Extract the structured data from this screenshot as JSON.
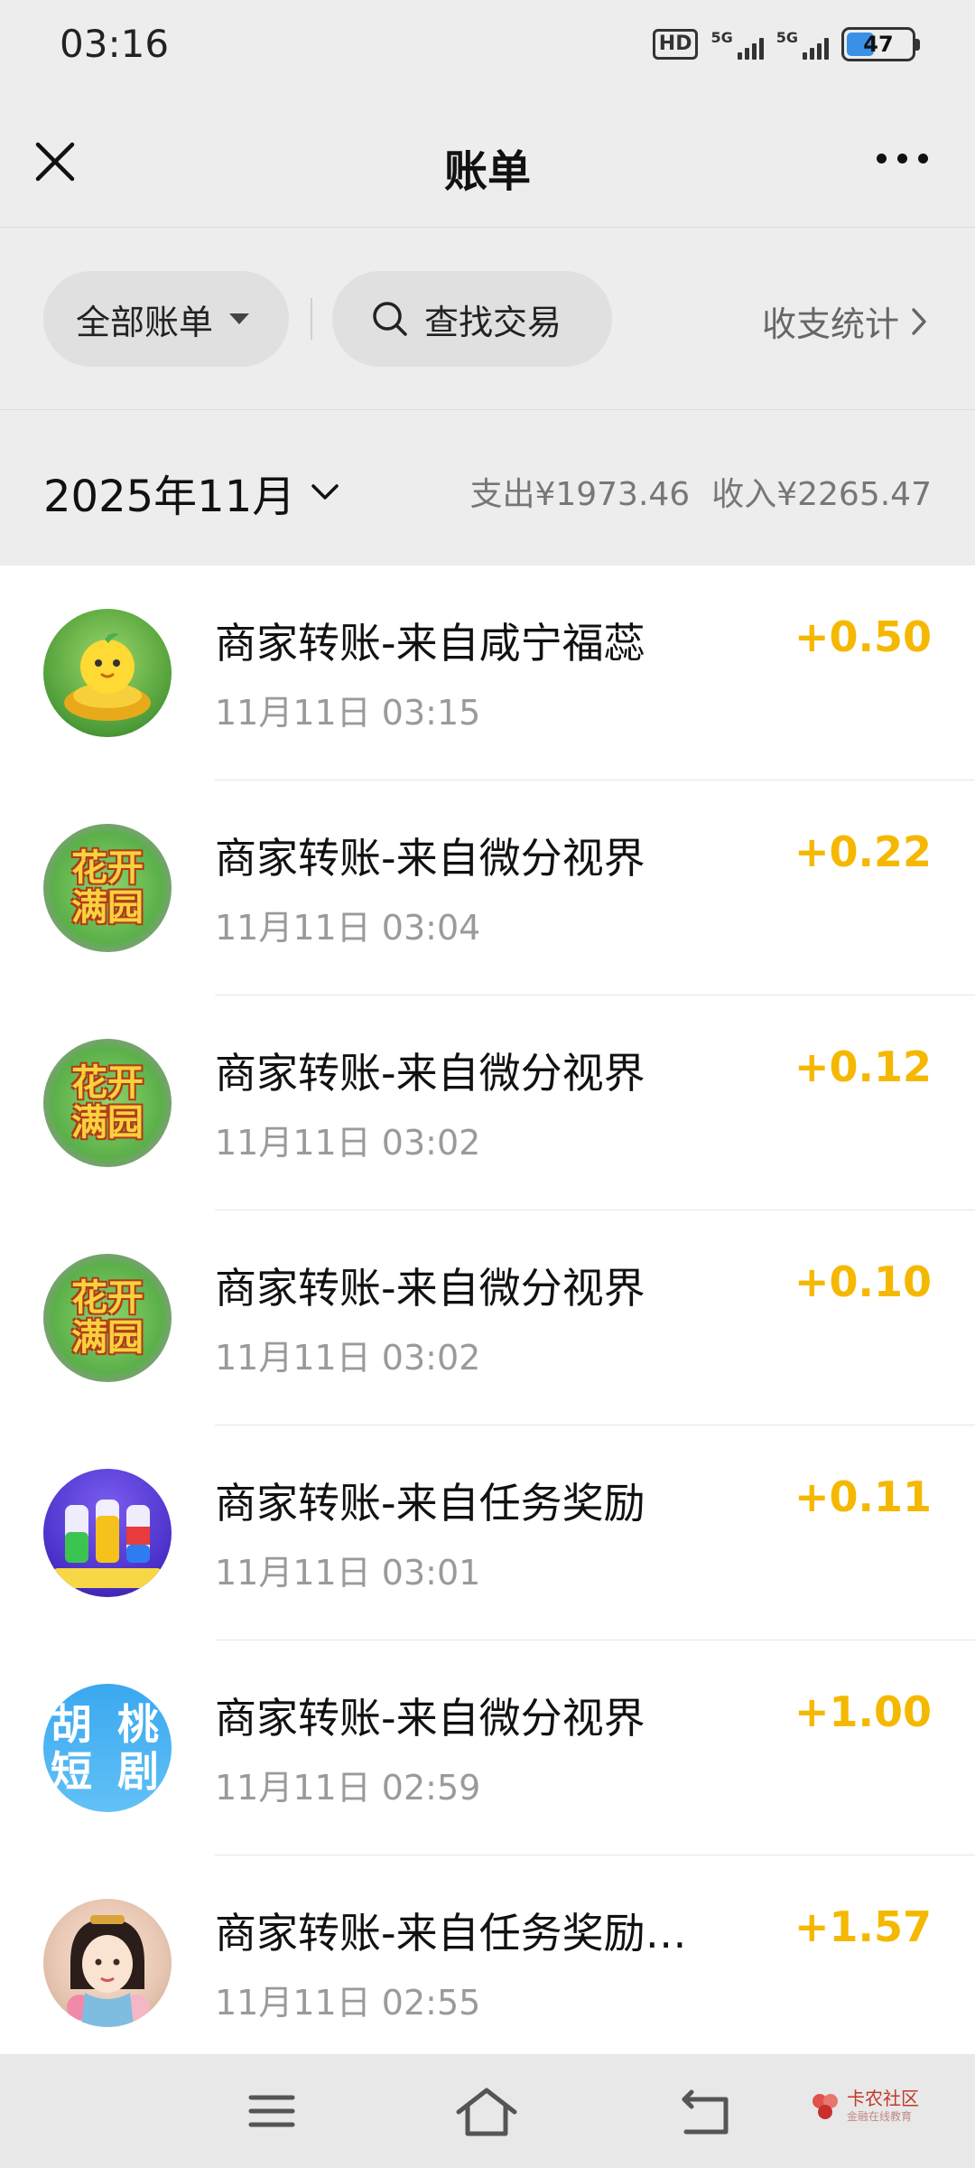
{
  "status_bar": {
    "time": "03:16",
    "hd": "HD",
    "signal_1": "5G",
    "signal_2": "5G",
    "battery": "47",
    "battery_level": 0.47
  },
  "header": {
    "title": "账单",
    "close_icon": "close-icon",
    "more_icon": "more-dots-icon"
  },
  "filters": {
    "all_bills": "全部账单",
    "search": "查找交易",
    "stats": "收支统计"
  },
  "month": {
    "label": "2025年11月",
    "expense": "支出¥1973.46",
    "income": "收入¥2265.47"
  },
  "transactions": [
    {
      "title": "商家转账-来自咸宁福蕊",
      "time": "11月11日 03:15",
      "amount": "+0.50",
      "avatar": "gold-ingot-chick"
    },
    {
      "title": "商家转账-来自微分视界",
      "time": "11月11日 03:04",
      "amount": "+0.22",
      "avatar": "flower-garden",
      "avatar_text_1": "花开",
      "avatar_text_2": "满园"
    },
    {
      "title": "商家转账-来自微分视界",
      "time": "11月11日 03:02",
      "amount": "+0.12",
      "avatar": "flower-garden",
      "avatar_text_1": "花开",
      "avatar_text_2": "满园"
    },
    {
      "title": "商家转账-来自微分视界",
      "time": "11月11日 03:02",
      "amount": "+0.10",
      "avatar": "flower-garden",
      "avatar_text_1": "花开",
      "avatar_text_2": "满园"
    },
    {
      "title": "商家转账-来自任务奖励",
      "time": "11月11日 03:01",
      "amount": "+0.11",
      "avatar": "color-bottles"
    },
    {
      "title": "商家转账-来自微分视界",
      "time": "11月11日 02:59",
      "amount": "+1.00",
      "avatar": "walnut-drama",
      "avatar_text_1": "胡 桃",
      "avatar_text_2": "短 剧"
    },
    {
      "title": "商家转账-来自任务奖励…",
      "time": "11月11日 02:55",
      "amount": "+1.57",
      "avatar": "lady-portrait"
    }
  ],
  "nav": {
    "menu_icon": "menu-icon",
    "home_icon": "home-icon",
    "back_icon": "back-icon"
  },
  "watermark": {
    "title": "卡农社区",
    "subtitle": "金融在线教育"
  },
  "colors": {
    "income_amount": "#f5b800",
    "background": "#ededed",
    "list_background": "#ffffff"
  }
}
